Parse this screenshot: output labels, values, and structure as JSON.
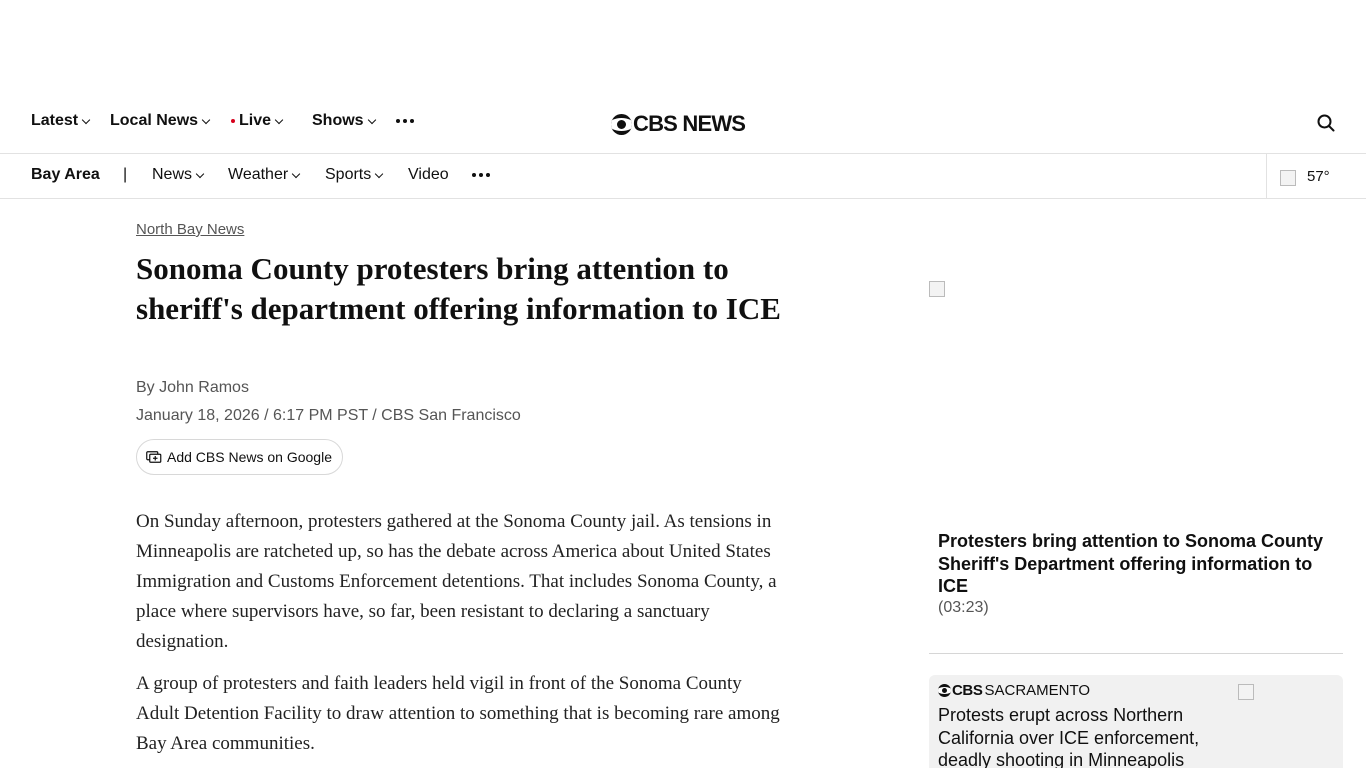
{
  "top_nav": {
    "items": [
      {
        "label": "Latest",
        "has_dropdown": true
      },
      {
        "label": "Local News",
        "has_dropdown": true
      },
      {
        "label": "Live",
        "has_dropdown": true,
        "live_dot_color": "#d6001c"
      },
      {
        "label": "Shows",
        "has_dropdown": true
      }
    ],
    "more_icon": "ellipsis-icon",
    "logo_text": "CBS NEWS",
    "search_icon": "search-icon"
  },
  "sub_nav": {
    "region": "Bay Area",
    "separator": "|",
    "items": [
      {
        "label": "News",
        "has_dropdown": true
      },
      {
        "label": "Weather",
        "has_dropdown": true
      },
      {
        "label": "Sports",
        "has_dropdown": true
      },
      {
        "label": "Video",
        "has_dropdown": false
      }
    ],
    "more_icon": "ellipsis-icon",
    "weather": {
      "temperature": "57°",
      "icon": "weather-icon"
    }
  },
  "article": {
    "eyebrow": "North Bay News",
    "headline": "Sonoma County protesters bring attention to sheriff's department offering information to ICE",
    "byline": "By John Ramos",
    "dateline": "January 18, 2026 / 6:17 PM PST / CBS San Francisco",
    "google_button": "Add CBS News on Google",
    "paragraphs": [
      "On Sunday afternoon, protesters gathered at the Sonoma County jail. As tensions in Minneapolis are ratcheted up, so has the debate across America about United States Immigration and Customs Enforcement detentions. That includes Sonoma County, a place where supervisors have, so far, been resistant to declaring a sanctuary designation.",
      "A group of protesters and faith leaders held vigil in front of the Sonoma County Adult Detention Facility to draw attention to something that is becoming rare among Bay Area communities."
    ]
  },
  "right_rail": {
    "video": {
      "title": "Protesters bring attention to Sonoma County Sheriff's Department offering information to ICE",
      "duration": "(03:23)"
    },
    "card": {
      "brand_bold": "CBS",
      "brand_rest": "SACRAMENTO",
      "title": "Protests erupt across Northern California over ICE enforcement, deadly shooting in Minneapolis"
    }
  },
  "colors": {
    "text": "#101010",
    "muted": "#555555",
    "divider": "#e2e2e2",
    "card_bg": "#f1f1f1",
    "live_red": "#d6001c"
  }
}
